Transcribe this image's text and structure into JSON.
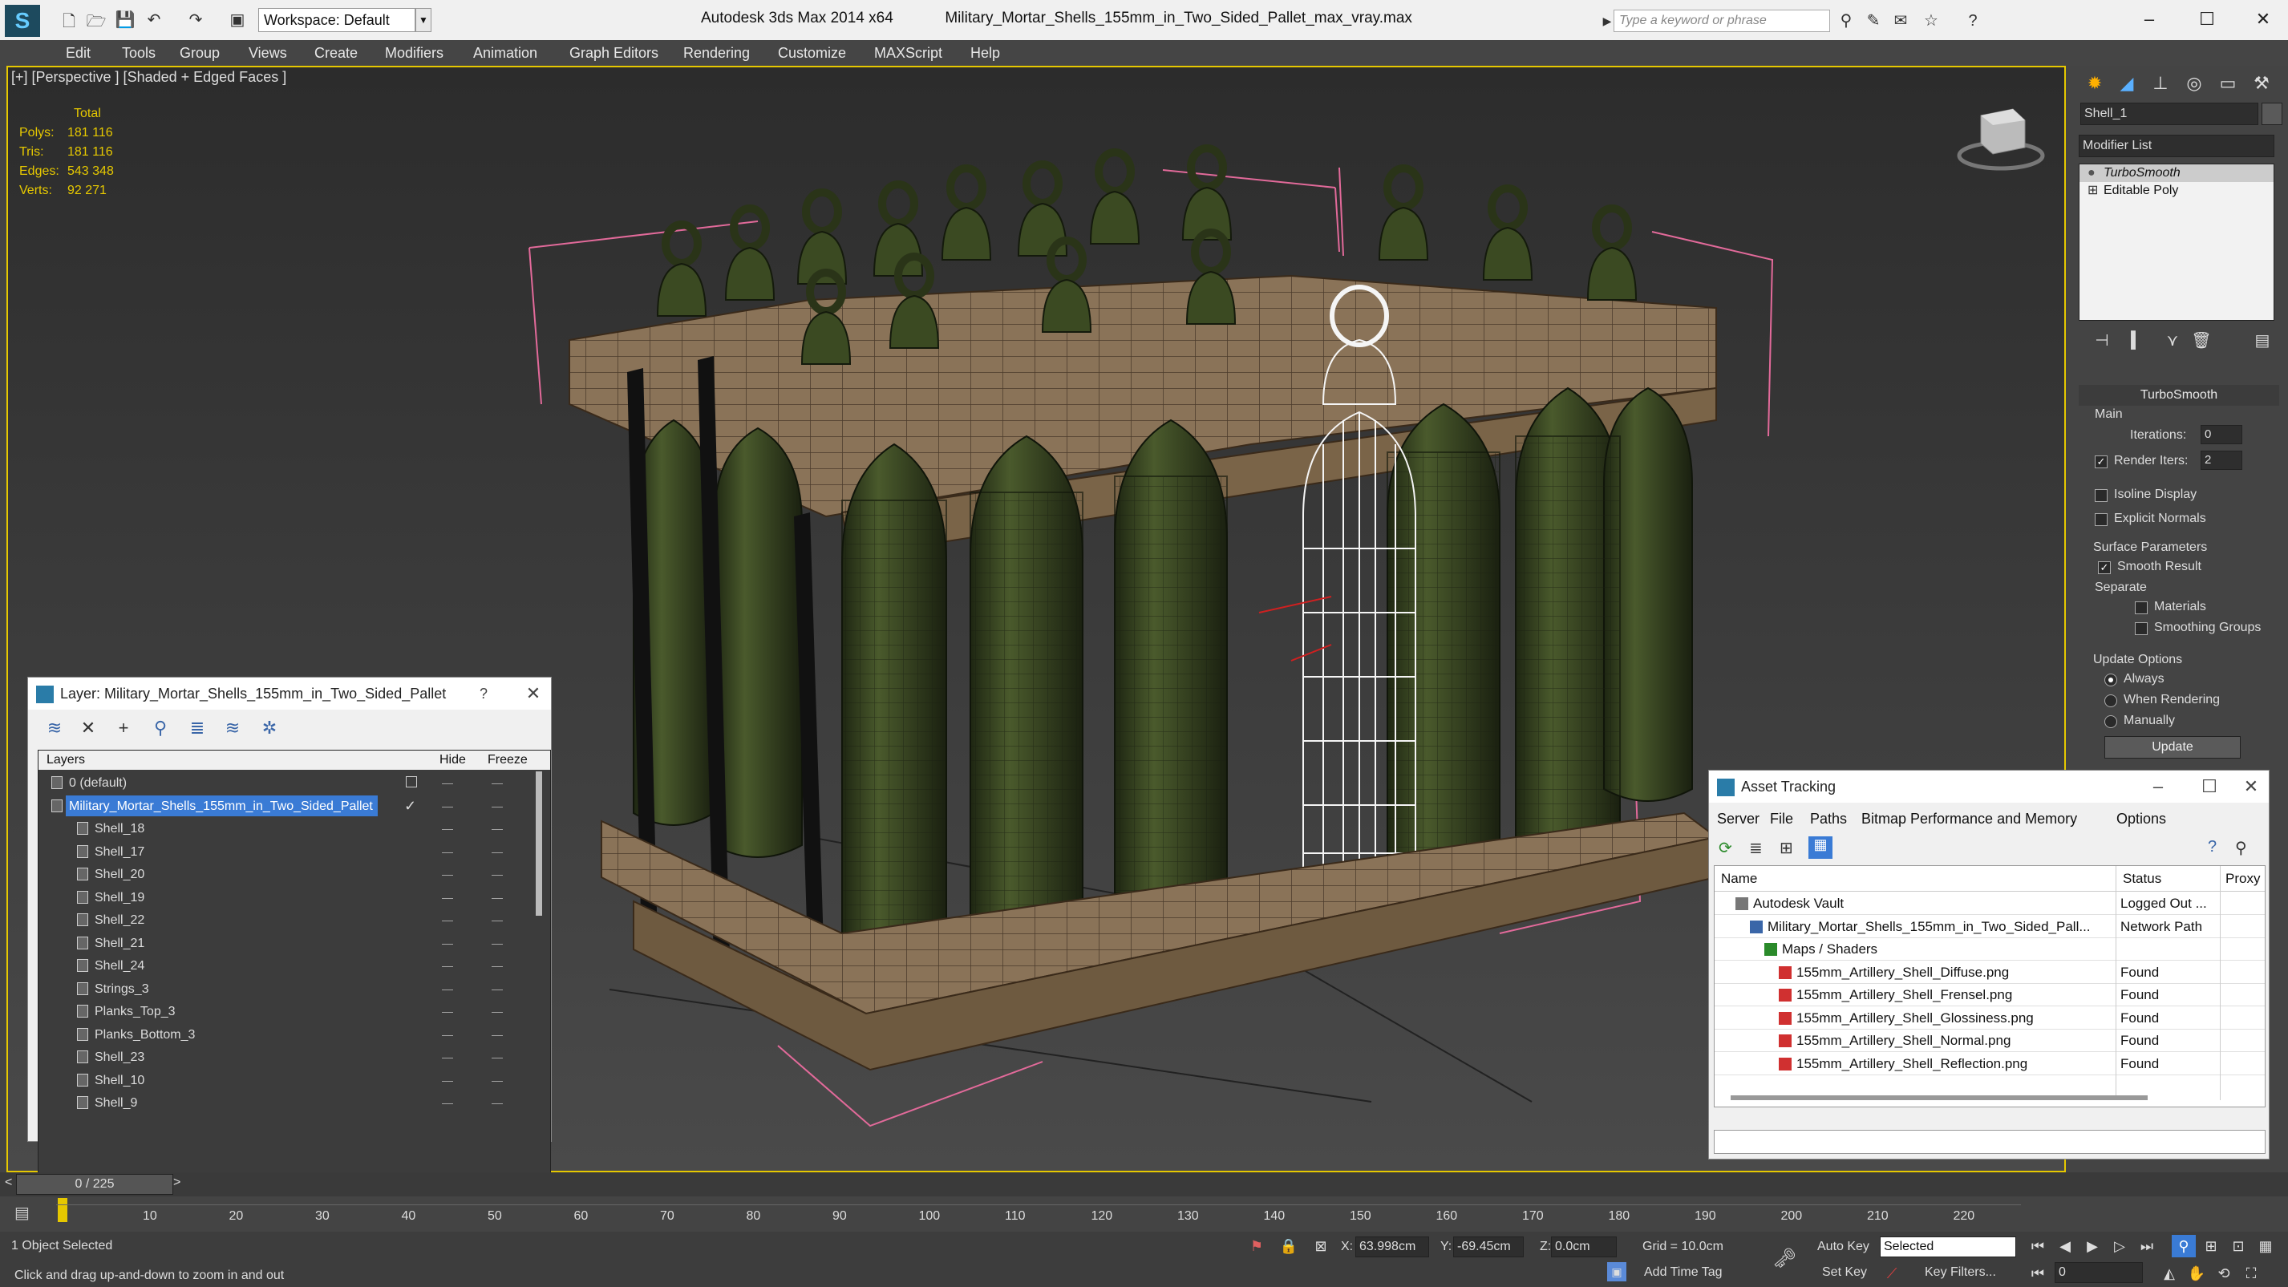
{
  "app": {
    "title": "Autodesk 3ds Max  2014 x64",
    "file": "Military_Mortar_Shells_155mm_in_Two_Sided_Pallet_max_vray.max",
    "workspace": "Workspace: Default",
    "search_placeholder": "Type a keyword or phrase"
  },
  "menu": [
    "Edit",
    "Tools",
    "Group",
    "Views",
    "Create",
    "Modifiers",
    "Animation",
    "Graph Editors",
    "Rendering",
    "Customize",
    "MAXScript",
    "Help"
  ],
  "viewport": {
    "label": "[+] [Perspective ] [Shaded + Edged Faces ]",
    "stats": {
      "header": "Total",
      "polys_label": "Polys:",
      "polys": "181 116",
      "tris_label": "Tris:",
      "tris": "181 116",
      "edges_label": "Edges:",
      "edges": "543 348",
      "verts_label": "Verts:",
      "verts": "92 271"
    }
  },
  "command_panel": {
    "object_name": "Shell_1",
    "modifier_list": "Modifier List",
    "stack": [
      "TurboSmooth",
      "Editable Poly"
    ],
    "turbosmooth": {
      "title": "TurboSmooth",
      "main": "Main",
      "iterations_label": "Iterations:",
      "iterations": "0",
      "render_iters_label": "Render Iters:",
      "render_iters": "2",
      "isoline": "Isoline Display",
      "explicit_normals": "Explicit Normals",
      "surface_params": "Surface Parameters",
      "smooth_result": "Smooth Result",
      "separate": "Separate",
      "materials": "Materials",
      "smoothing_groups": "Smoothing Groups",
      "update_options": "Update Options",
      "always": "Always",
      "when_rendering": "When Rendering",
      "manually": "Manually",
      "update_btn": "Update"
    }
  },
  "layer_dialog": {
    "title": "Layer: Military_Mortar_Shells_155mm_in_Two_Sided_Pallet",
    "help": "?",
    "col_layers": "Layers",
    "col_hide": "Hide",
    "col_freeze": "Freeze",
    "rows": [
      {
        "name": "0 (default)",
        "indent": 0,
        "sel": false
      },
      {
        "name": "Military_Mortar_Shells_155mm_in_Two_Sided_Pallet",
        "indent": 0,
        "sel": true
      },
      {
        "name": "Shell_18",
        "indent": 1,
        "sel": false
      },
      {
        "name": "Shell_17",
        "indent": 1,
        "sel": false
      },
      {
        "name": "Shell_20",
        "indent": 1,
        "sel": false
      },
      {
        "name": "Shell_19",
        "indent": 1,
        "sel": false
      },
      {
        "name": "Shell_22",
        "indent": 1,
        "sel": false
      },
      {
        "name": "Shell_21",
        "indent": 1,
        "sel": false
      },
      {
        "name": "Shell_24",
        "indent": 1,
        "sel": false
      },
      {
        "name": "Strings_3",
        "indent": 1,
        "sel": false
      },
      {
        "name": "Planks_Top_3",
        "indent": 1,
        "sel": false
      },
      {
        "name": "Planks_Bottom_3",
        "indent": 1,
        "sel": false
      },
      {
        "name": "Shell_23",
        "indent": 1,
        "sel": false
      },
      {
        "name": "Shell_10",
        "indent": 1,
        "sel": false
      },
      {
        "name": "Shell_9",
        "indent": 1,
        "sel": false
      }
    ]
  },
  "asset_tracking": {
    "title": "Asset Tracking",
    "menu": [
      "Server",
      "File",
      "Paths",
      "Bitmap Performance and Memory",
      "Options"
    ],
    "col_name": "Name",
    "col_status": "Status",
    "col_proxy": "Proxy",
    "rows": [
      {
        "name": "Autodesk Vault",
        "status": "Logged Out ...",
        "indent": 1,
        "icon": "vault"
      },
      {
        "name": "Military_Mortar_Shells_155mm_in_Two_Sided_Pall...",
        "status": "Network Path",
        "indent": 2,
        "icon": "max"
      },
      {
        "name": "Maps / Shaders",
        "status": "",
        "indent": 3,
        "icon": "maps"
      },
      {
        "name": "155mm_Artillery_Shell_Diffuse.png",
        "status": "Found",
        "indent": 4,
        "icon": "png"
      },
      {
        "name": "155mm_Artillery_Shell_Frensel.png",
        "status": "Found",
        "indent": 4,
        "icon": "png"
      },
      {
        "name": "155mm_Artillery_Shell_Glossiness.png",
        "status": "Found",
        "indent": 4,
        "icon": "png"
      },
      {
        "name": "155mm_Artillery_Shell_Normal.png",
        "status": "Found",
        "indent": 4,
        "icon": "png"
      },
      {
        "name": "155mm_Artillery_Shell_Reflection.png",
        "status": "Found",
        "indent": 4,
        "icon": "png"
      }
    ]
  },
  "timeline": {
    "frame": "0 / 225",
    "ticks": [
      "10",
      "20",
      "30",
      "40",
      "50",
      "60",
      "70",
      "80",
      "90",
      "100",
      "110",
      "120",
      "130",
      "140",
      "150",
      "160",
      "170",
      "180",
      "190",
      "200",
      "210",
      "220"
    ]
  },
  "status": {
    "selected": "1 Object Selected",
    "prompt": "Click and drag up-and-down to zoom in and out",
    "x_label": "X:",
    "x": "63.998cm",
    "y_label": "Y:",
    "y": "-69.45cm",
    "z_label": "Z:",
    "z": "0.0cm",
    "grid": "Grid = 10.0cm",
    "add_time_tag": "Add Time Tag",
    "auto_key": "Auto Key",
    "set_key": "Set Key",
    "key_filter_value": "Selected",
    "key_filters": "Key Filters...",
    "frame_field": "0"
  },
  "colors": {
    "accent": "#3a7bd5",
    "viewport_border": "#e6c800",
    "shell": "#3b4a22",
    "wood": "#8a7358"
  }
}
